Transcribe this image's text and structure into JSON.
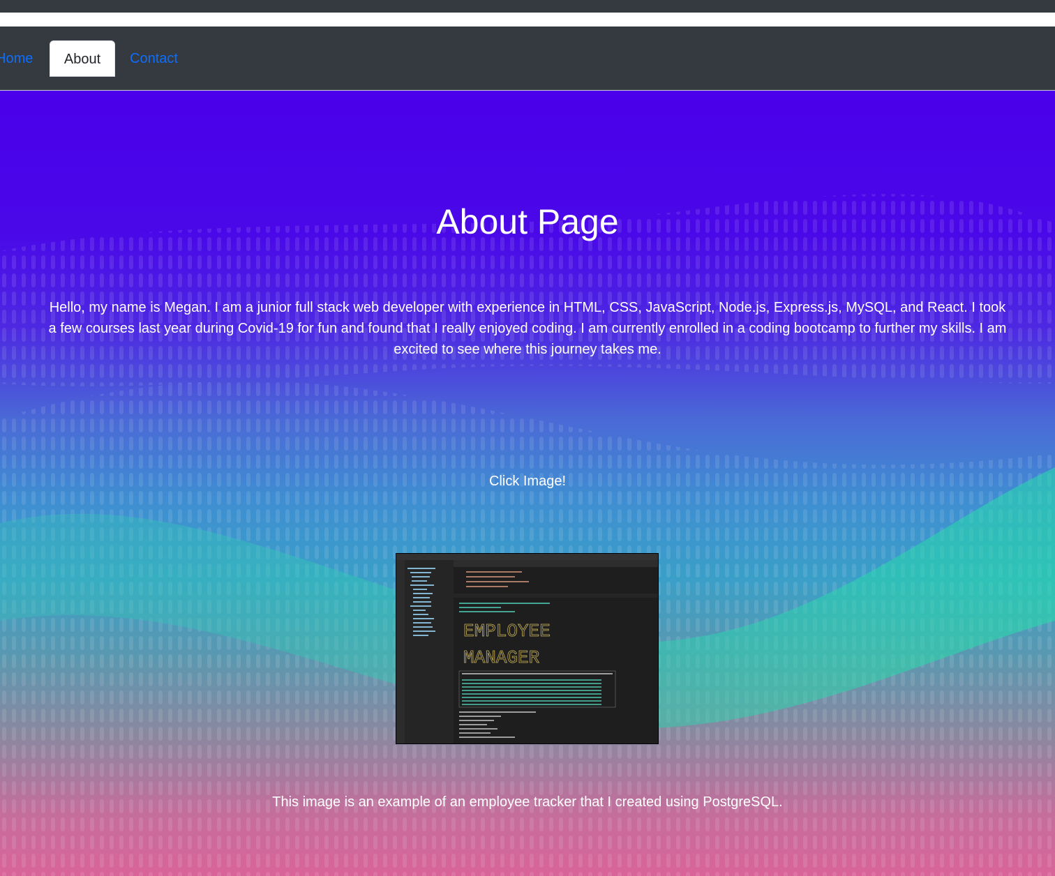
{
  "nav": {
    "home_label": "Home",
    "about_label": "About",
    "contact_label": "Contact",
    "link_color": "#0d6efd",
    "bar_color": "#343a40"
  },
  "main": {
    "title": "About Page",
    "intro": "Hello, my name is Megan. I am a junior full stack web developer with experience in HTML, CSS, JavaScript, Node.js, Express.js, MySQL, and React. I took a few courses last year during Covid-19 for fun and found that I really enjoyed coding. I am currently enrolled in a coding bootcamp to further my skills. I am excited to see where this journey takes me.",
    "cta": "Click Image!",
    "caption": "This image is an example of an employee tracker that I created using PostgreSQL."
  },
  "screenshot": {
    "banner_line1": "EMPLOYEE",
    "banner_line2": "MANAGER"
  },
  "colors": {
    "gradient_top": "#4a00ea",
    "gradient_mid": "#3a9fc8",
    "gradient_bottom": "#d9649a",
    "text": "#ffffff"
  }
}
